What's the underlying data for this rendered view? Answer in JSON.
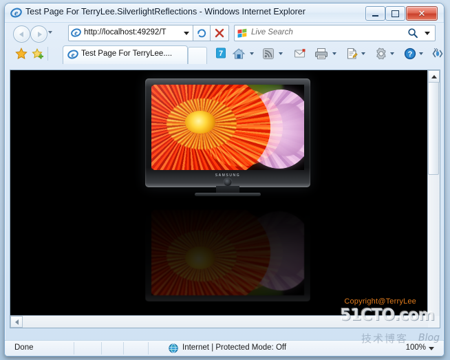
{
  "window": {
    "title": "Test Page For TerryLee.SilverlightReflections - Windows Internet Explorer",
    "app_icon": "internet-explorer-icon",
    "controls": {
      "minimize": "Minimize",
      "maximize": "Maximize",
      "close": "Close",
      "close_glyph": "✕"
    }
  },
  "navigation": {
    "back_label": "Back",
    "forward_label": "Forward",
    "history_label": "Recent Pages",
    "address": {
      "value": "http://localhost:49292/T",
      "placeholder": "Address",
      "icon": "internet-explorer-icon"
    },
    "refresh_label": "Refresh",
    "stop_label": "Stop",
    "search": {
      "placeholder": "Live Search",
      "logo": "windows-flag-icon",
      "go_label": "Search",
      "dropdown_label": "Search Options"
    }
  },
  "tabs": {
    "favorites_label": "Favorites Center",
    "add_favorite_label": "Add to Favorites",
    "items": [
      {
        "label": "Test Page For TerryLee....",
        "icon": "internet-explorer-icon",
        "active": true
      }
    ],
    "new_tab_label": "New Tab"
  },
  "command_bar": {
    "items": [
      {
        "name": "suggested-sites-badge",
        "label": "7",
        "has_dropdown": false
      },
      {
        "name": "home",
        "label": "Home",
        "has_dropdown": true
      },
      {
        "name": "feeds",
        "label": "Feeds",
        "has_dropdown": true
      },
      {
        "name": "read-mail",
        "label": "Read Mail",
        "has_dropdown": false
      },
      {
        "name": "print",
        "label": "Print",
        "has_dropdown": true
      },
      {
        "name": "page",
        "label": "Page",
        "has_dropdown": true
      },
      {
        "name": "tools",
        "label": "Tools",
        "has_dropdown": true
      },
      {
        "name": "help",
        "label": "Help",
        "has_dropdown": true
      },
      {
        "name": "discuss",
        "label": "Discuss",
        "has_dropdown": false
      }
    ],
    "overflow_label": "»"
  },
  "page_content": {
    "background_color": "#000000",
    "tv": {
      "brand": "SAMSUNG",
      "screen_subject": "red dahlia flower with pink dahlia",
      "reflection": true
    },
    "copyright": "Copyright@TerryLee",
    "copyright_color": "#e07b1d"
  },
  "scrollbars": {
    "vertical_up_label": "Scroll Up",
    "horizontal_left_label": "Scroll Left"
  },
  "status_bar": {
    "status_text": "Done",
    "zone_icon": "globe-icon",
    "zone_text": "Internet | Protected Mode: Off",
    "zoom_level": "100%",
    "zoom_dropdown_label": "Change Zoom Level"
  },
  "watermark": {
    "site": "51CTO.com",
    "chinese": "技术博客",
    "blog": "Blog"
  }
}
